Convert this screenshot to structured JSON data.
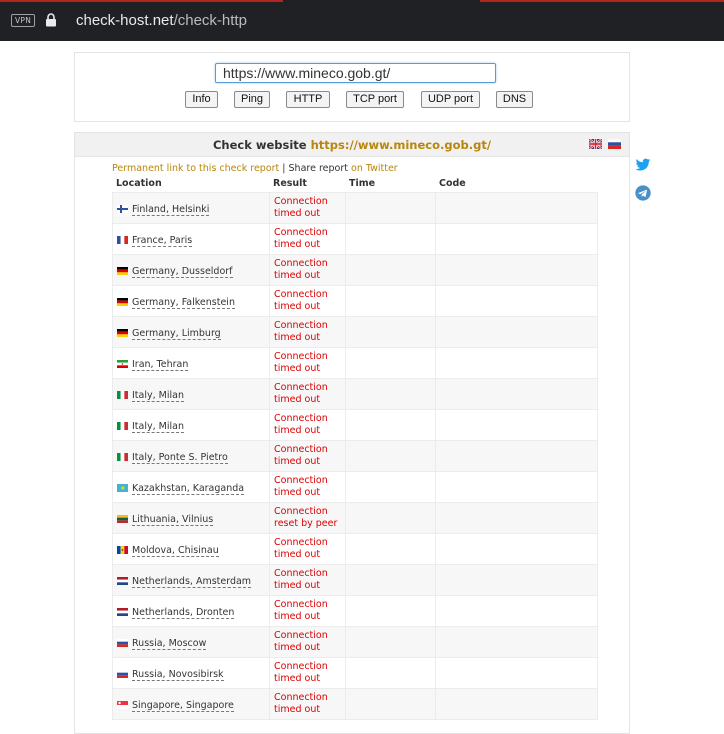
{
  "browser": {
    "vpn_label": "VPN",
    "url_host": "check-host.net",
    "url_path": "/check-http"
  },
  "form": {
    "url_value": "https://www.mineco.gob.gt/",
    "buttons": [
      "Info",
      "Ping",
      "HTTP",
      "TCP port",
      "UDP port",
      "DNS"
    ]
  },
  "results": {
    "title_prefix": "Check website",
    "title_target": "https://www.mineco.gob.gt/",
    "permalink_text": "Permanent link to this check report",
    "separator": "|",
    "share_text": "Share report",
    "twitter_text": "on Twitter",
    "columns": [
      "Location",
      "Result",
      "Time",
      "Code"
    ],
    "rows": [
      {
        "flag": "fi",
        "location": "Finland, Helsinki",
        "result": [
          "Connection",
          "timed out"
        ]
      },
      {
        "flag": "fr",
        "location": "France, Paris",
        "result": [
          "Connection",
          "timed out"
        ]
      },
      {
        "flag": "de",
        "location": "Germany, Dusseldorf",
        "result": [
          "Connection",
          "timed out"
        ]
      },
      {
        "flag": "de",
        "location": "Germany, Falkenstein",
        "result": [
          "Connection",
          "timed out"
        ]
      },
      {
        "flag": "de",
        "location": "Germany, Limburg",
        "result": [
          "Connection",
          "timed out"
        ]
      },
      {
        "flag": "ir",
        "location": "Iran, Tehran",
        "result": [
          "Connection",
          "timed out"
        ]
      },
      {
        "flag": "it",
        "location": "Italy, Milan",
        "result": [
          "Connection",
          "timed out"
        ]
      },
      {
        "flag": "it",
        "location": "Italy, Milan",
        "result": [
          "Connection",
          "timed out"
        ]
      },
      {
        "flag": "it",
        "location": "Italy, Ponte S. Pietro",
        "result": [
          "Connection",
          "timed out"
        ]
      },
      {
        "flag": "kz",
        "location": "Kazakhstan, Karaganda",
        "result": [
          "Connection",
          "timed out"
        ]
      },
      {
        "flag": "lt",
        "location": "Lithuania, Vilnius",
        "result": [
          "Connection",
          "reset by peer"
        ]
      },
      {
        "flag": "md",
        "location": "Moldova, Chisinau",
        "result": [
          "Connection",
          "timed out"
        ]
      },
      {
        "flag": "nl",
        "location": "Netherlands, Amsterdam",
        "result": [
          "Connection",
          "timed out"
        ]
      },
      {
        "flag": "nl",
        "location": "Netherlands, Dronten",
        "result": [
          "Connection",
          "timed out"
        ]
      },
      {
        "flag": "ru",
        "location": "Russia, Moscow",
        "result": [
          "Connection",
          "timed out"
        ]
      },
      {
        "flag": "ru",
        "location": "Russia, Novosibirsk",
        "result": [
          "Connection",
          "timed out"
        ]
      },
      {
        "flag": "sg",
        "location": "Singapore, Singapore",
        "result": [
          "Connection",
          "timed out"
        ]
      }
    ]
  },
  "colors": {
    "accent_link": "#b8860b",
    "error_text": "#dd0000",
    "browser_bar": "#202124",
    "twitter": "#1da1f2",
    "telegram": "#4a90c8"
  },
  "icons": [
    "lock-icon",
    "uk-flag-icon",
    "ru-flag-icon",
    "twitter-icon",
    "telegram-icon"
  ]
}
